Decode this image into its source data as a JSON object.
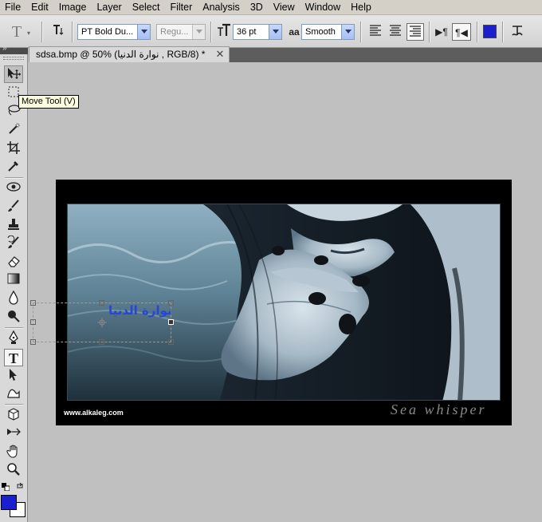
{
  "menubar": {
    "items": [
      "File",
      "Edit",
      "Image",
      "Layer",
      "Select",
      "Filter",
      "Analysis",
      "3D",
      "View",
      "Window",
      "Help"
    ]
  },
  "options": {
    "tool_preset_icon": "T",
    "orientation_icon": "T-vertical-toggle",
    "font_family": "PT Bold Du...",
    "font_style": "Regu...",
    "font_size_icon": "T-size",
    "font_size": "36 pt",
    "aa_icon": "aa",
    "anti_alias": "Smooth",
    "color_swatch": "#1a1fd0"
  },
  "document": {
    "tab_title": "sdsa.bmp @ 50% (نوارة الدنيا , RGB/8) *",
    "close_label": "✕",
    "text_layer": "نوارة الدنيا",
    "watermark": "www.alkaleg.com",
    "signature": "Sea whisper"
  },
  "tooltip": {
    "text": "Move Tool (V)"
  },
  "colors": {
    "foreground": "#1a1fd0",
    "background": "#ffffff",
    "text_layer": "#2746d3"
  },
  "tools": [
    "move-icon",
    "marquee-icon",
    "lasso-icon",
    "quick-select-icon",
    "crop-icon",
    "eyedropper-icon",
    "red-eye-icon",
    "brush-icon",
    "clone-stamp-icon",
    "history-brush-icon",
    "eraser-icon",
    "gradient-icon",
    "blur-icon",
    "dodge-icon",
    "pen-icon",
    "type-icon",
    "path-select-icon",
    "shape-icon",
    "3d-rotate-icon",
    "3d-camera-icon",
    "hand-icon",
    "zoom-icon"
  ]
}
